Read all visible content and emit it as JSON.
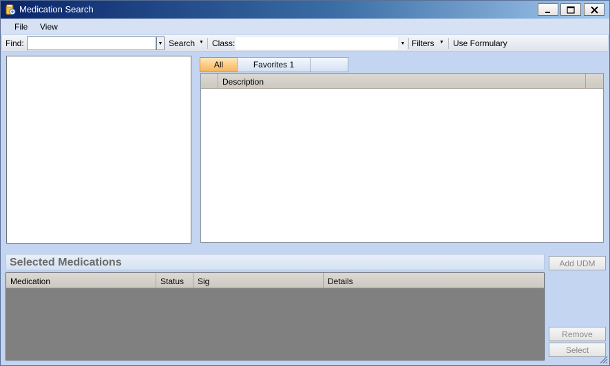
{
  "window": {
    "title": "Medication Search",
    "icon": "prescription-icon"
  },
  "menu": {
    "items": [
      "File",
      "View"
    ]
  },
  "toolbar": {
    "find_label": "Find:",
    "find_value": "",
    "search_label": "Search",
    "class_label": "Class:",
    "class_value": "",
    "filters_label": "Filters",
    "formulary_label": "Use Formulary"
  },
  "tabs": [
    {
      "label": "All",
      "selected": true
    },
    {
      "label": "Favorites 1",
      "selected": false
    },
    {
      "label": "",
      "selected": false
    }
  ],
  "description_grid": {
    "columns": [
      "Description"
    ]
  },
  "selected_medications": {
    "title": "Selected Medications",
    "columns": [
      "Medication",
      "Status",
      "Sig",
      "Details"
    ]
  },
  "buttons": {
    "add_udm": "Add UDM",
    "remove": "Remove",
    "select": "Select"
  },
  "colors": {
    "title_start": "#0a246a",
    "window_bg": "#c3d5f0",
    "tab_selected": "#f8b55a",
    "grid_bg": "#808080"
  }
}
